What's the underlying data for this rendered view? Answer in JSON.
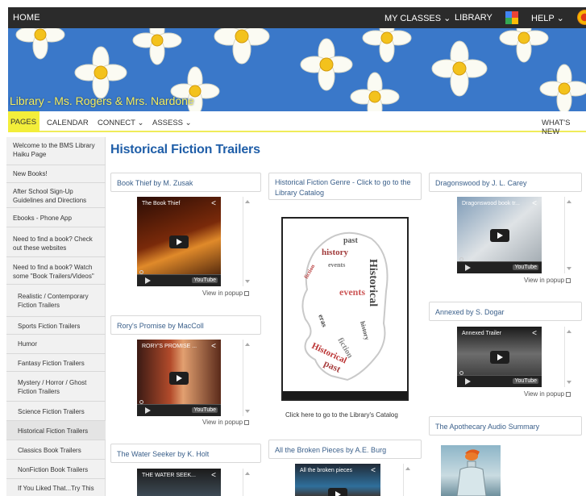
{
  "topnav": {
    "home": "HOME",
    "my_classes": "MY CLASSES",
    "library": "LIBRARY",
    "help": "HELP",
    "chevron": "⌄",
    "icons": [
      "google-apps-icon",
      "sun-avatar-icon"
    ]
  },
  "banner": {
    "title": "Library - Ms. Rogers & Mrs. Nardone"
  },
  "subnav": {
    "pages": "PAGES",
    "calendar": "CALENDAR",
    "connect": "CONNECT",
    "assess": "ASSESS",
    "whats_new": "WHAT'S NEW",
    "chevron": "⌄",
    "accent_color": "#f3ee3a"
  },
  "sidebar": {
    "items": [
      "Welcome to the BMS Library Haiku Page",
      "New Books!",
      "After School Sign-Up Guidelines and Directions",
      "Ebooks - Phone App",
      "Need to find a book? Check out these websites",
      "Need to find a book? Watch some \"Book Trailers/Videos\"",
      "Realistic / Contemporary Fiction Trailers",
      "Sports Fiction Trailers",
      "Humor",
      "Fantasy Fiction Trailers",
      "Mystery / Horror / Ghost Fiction Trailers",
      "Science Fiction Trailers",
      "Historical Fiction Trailers",
      "Classics Book Trailers",
      "NonFiction Book Trailers",
      "If You Liked That...Try This"
    ]
  },
  "main": {
    "heading": "Historical Fiction Trailers",
    "heading_color": "#1f5ea8",
    "col1": {
      "card1": "Book Thief by M. Zusak",
      "video1": "The Book Thief",
      "card2": "Rory's Promise by MacColl",
      "video2": "RORY'S PROMISE ...",
      "card3": "The Water Seeker by K. Holt",
      "video3": "THE WATER SEEK..."
    },
    "col2": {
      "card1": "Historical Fiction Genre - Click to go to the Library Catalog",
      "catalog_caption": "Click here to go to the Library's Catalog",
      "card2": "All the Broken Pieces by A.E. Burg",
      "video": "All the broken pieces"
    },
    "col3": {
      "card1": "Dragonswood by J. L. Carey",
      "video1": "Dragonswood book tr...",
      "card2": "Annexed by S. Dogar",
      "video2": "Annexed Trailer",
      "card3": "The Apothecary Audio Summary"
    },
    "view_in_popup": "View in popup",
    "youtube": "YouTube",
    "share_icon": "share-icon"
  }
}
